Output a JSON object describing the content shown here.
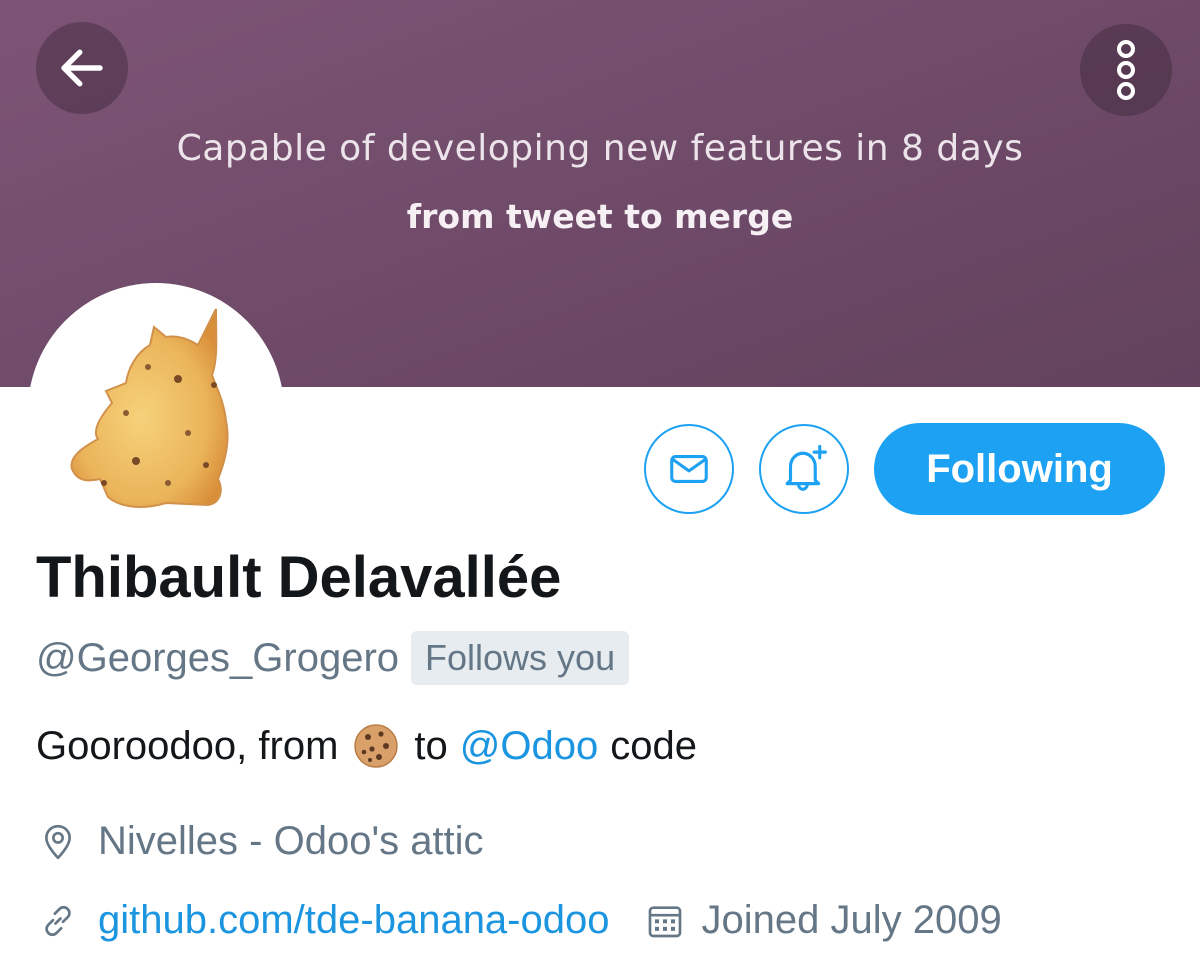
{
  "banner": {
    "line1": "Capable of developing new features in 8 days",
    "line2": "from tweet to merge",
    "back_icon": "arrow-left-icon",
    "more_icon": "vertical-ellipsis-icon",
    "color": "#6e4a68"
  },
  "actions": {
    "message_icon": "envelope-icon",
    "notify_icon": "bell-plus-icon",
    "follow_label": "Following",
    "accent": "#1da1f2"
  },
  "profile": {
    "name": "Thibault Delavallée",
    "handle": "@Georges_Grogero",
    "follows_you": "Follows you",
    "avatar_icon": "unicorn-cookie-avatar"
  },
  "bio": {
    "prefix": "Gooroodoo, from",
    "emoji_icon": "cookie-emoji",
    "middle": "to",
    "mention": "@Odoo",
    "suffix": "code"
  },
  "meta": {
    "location_icon": "location-pin-icon",
    "location": "Nivelles - Odoo's attic",
    "link_icon": "link-icon",
    "link": "github.com/tde-banana-odoo",
    "joined_icon": "calendar-icon",
    "joined": "Joined July 2009",
    "link_color": "#1b95e0"
  }
}
